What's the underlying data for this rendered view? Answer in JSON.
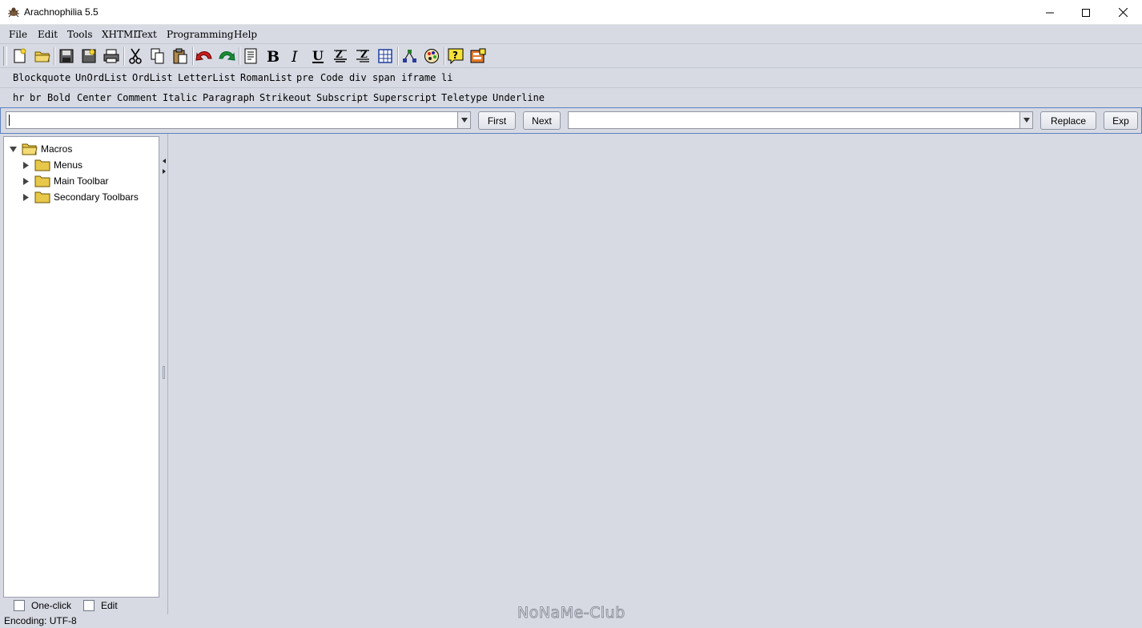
{
  "window": {
    "title": "Arachnophilia 5.5",
    "controls": [
      "minimize",
      "maximize",
      "close"
    ]
  },
  "menu": [
    "File",
    "Edit",
    "Tools",
    "XHTML",
    "Text",
    "Programming",
    "Help"
  ],
  "toolbar": {
    "icons": [
      "new-file-icon",
      "open-folder-icon",
      "save-icon",
      "save-all-icon",
      "print-icon",
      "cut-icon",
      "copy-icon",
      "paste-icon",
      "undo-icon",
      "redo-icon",
      "document-icon",
      "bold-icon",
      "italic-icon",
      "underline-icon",
      "center-align-icon",
      "right-align-icon",
      "table-icon",
      "tree-structure-icon",
      "color-palette-icon",
      "help-icon",
      "macro-icon"
    ]
  },
  "tagbar1": [
    "Blockquote",
    "UnOrdList",
    "OrdList",
    "LetterList",
    "RomanList",
    "pre",
    "Code",
    "div",
    "span",
    "iframe",
    "li"
  ],
  "tagbar2": [
    "hr",
    "br",
    "Bold",
    "Center",
    "Comment",
    "Italic",
    "Paragraph",
    "Strikeout",
    "Subscript",
    "Superscript",
    "Teletype",
    "Underline"
  ],
  "find": {
    "search_value": "",
    "first_label": "First",
    "next_label": "Next",
    "replace_value": "",
    "replace_label": "Replace",
    "exp_label": "Exp"
  },
  "tree": {
    "root": "Macros",
    "children": [
      "Menus",
      "Main Toolbar",
      "Secondary Toolbars"
    ]
  },
  "options": {
    "one_click_label": "One-click",
    "edit_label": "Edit"
  },
  "status": {
    "encoding": "Encoding: UTF-8"
  },
  "watermark": "NoNaMe-Club",
  "colors": {
    "background": "#d7dae3",
    "folder": "#e8c84a",
    "accent_border": "#5a82c0"
  }
}
